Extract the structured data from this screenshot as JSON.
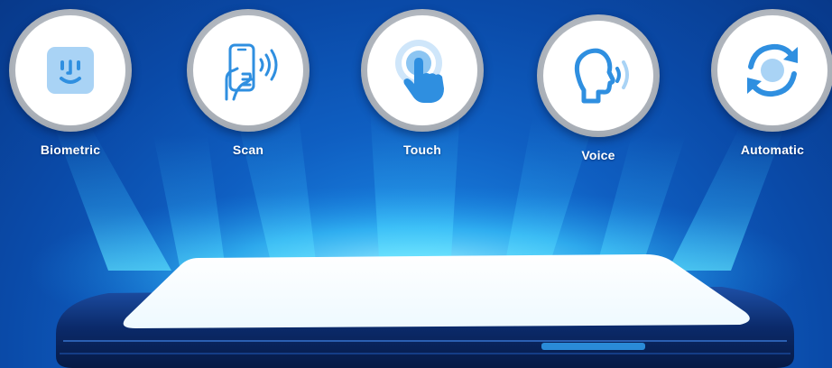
{
  "methods": [
    {
      "label": "Biometric",
      "icon": "face-recognition-icon"
    },
    {
      "label": "Scan",
      "icon": "phone-scan-icon"
    },
    {
      "label": "Touch",
      "icon": "touch-icon"
    },
    {
      "label": "Voice",
      "icon": "voice-icon"
    },
    {
      "label": "Automatic",
      "icon": "sync-icon"
    }
  ],
  "colors": {
    "background": "#0a4aa8",
    "glow": "#39c6ff",
    "icon_blue": "#2f8fe0",
    "icon_light": "#a9d3f5",
    "badge_ring": "#a7adb5"
  }
}
